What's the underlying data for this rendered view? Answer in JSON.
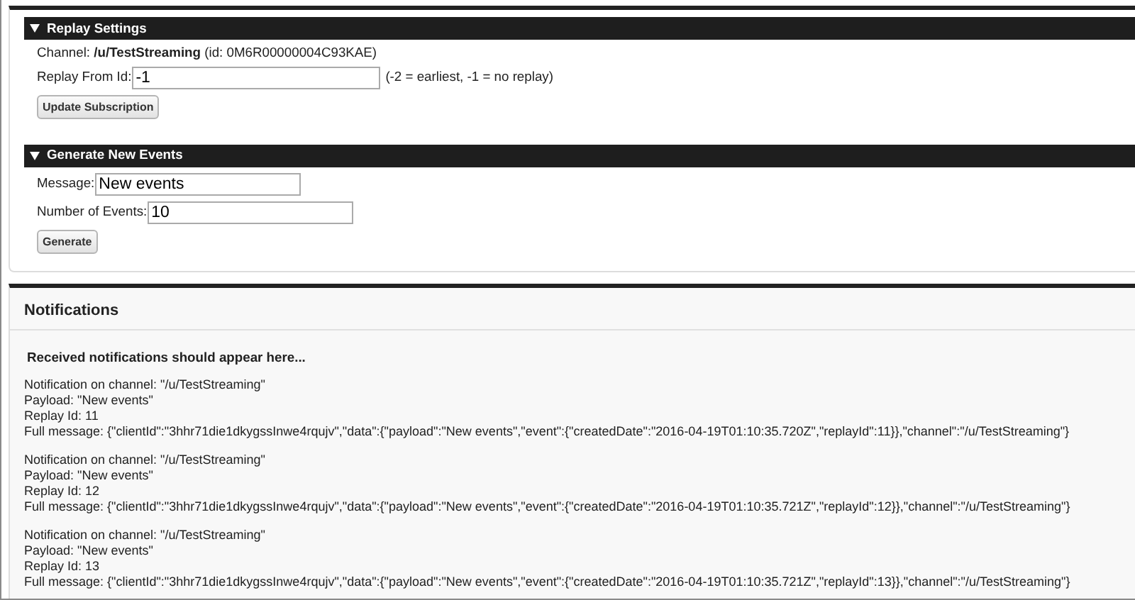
{
  "replay_settings": {
    "title": "Replay Settings",
    "expanded": true,
    "channel_line": "Channel:  **/u/TestStreaming** (id:  0M6R00000004C93KAE)",
    "replay_label": "Replay From Id:",
    "replay_value": "-1",
    "replay_hint": "(-2 = earliest, -1 = no replay)",
    "button": "Update Subscription"
  },
  "generate": {
    "title": "Generate New Events",
    "expanded": true,
    "fields": [
      {
        "label": "Message:",
        "value": "New events"
      },
      {
        "label": "Number of Events:",
        "value": "10"
      }
    ],
    "button": "Generate"
  },
  "notifications": {
    "title": "Notifications",
    "intro": "Received notifications should appear here...",
    "items": [
      {
        "lines": [
          "Notification on channel: \"/u/TestStreaming\"",
          "Payload: \"New events\"",
          "Replay Id: 11",
          "Full message: {\"clientId\":\"3hhr71die1dkygssInwe4rqujv\",\"data\":{\"payload\":\"New events\",\"event\":{\"createdDate\":\"2016-04-19T01:10:35.720Z\",\"replayId\":11}},\"channel\":\"/u/TestStreaming\"}"
        ]
      },
      {
        "lines": [
          "Notification on channel: \"/u/TestStreaming\"",
          "Payload: \"New events\"",
          "Replay Id: 12",
          "Full message: {\"clientId\":\"3hhr71die1dkygssInwe4rqujv\",\"data\":{\"payload\":\"New events\",\"event\":{\"createdDate\":\"2016-04-19T01:10:35.721Z\",\"replayId\":12}},\"channel\":\"/u/TestStreaming\"}"
        ]
      },
      {
        "lines": [
          "Notification on channel: \"/u/TestStreaming\"",
          "Payload: \"New events\"",
          "Replay Id: 13",
          "Full message: {\"clientId\":\"3hhr71die1dkygssInwe4rqujv\",\"data\":{\"payload\":\"New events\",\"event\":{\"createdDate\":\"2016-04-19T01:10:35.721Z\",\"replayId\":13}},\"channel\":\"/u/TestStreaming\"}"
        ]
      }
    ]
  }
}
